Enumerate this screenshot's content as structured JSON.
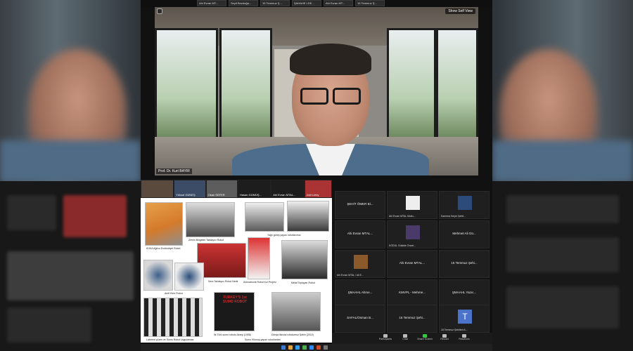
{
  "window": {
    "title": ""
  },
  "top_strip": {
    "tiles": [
      {
        "label": "Ahi Evran MT..."
      },
      {
        "label": "Seyit Bozdoğa..."
      },
      {
        "label": "15 Temmuz Ş..."
      },
      {
        "label": "ŞAHAHE LDE..."
      },
      {
        "label": "Ahi Evran MT..."
      },
      {
        "label": "15 Temmuz Ş..."
      }
    ]
  },
  "speaker": {
    "show_self_view": "Show Self View",
    "name": "Prof. Dr. Kurt BAYIR"
  },
  "share": {
    "strip": [
      {
        "label": ""
      },
      {
        "label": "Yüksel GÜNEŞ"
      },
      {
        "label": "Okan SEFER"
      },
      {
        "label": "Hasan GÜMÜŞ..."
      },
      {
        "label": "Ahi Evran MTAL..."
      },
      {
        "label": "Joel Lleby"
      }
    ],
    "captions": {
      "kuka": "KUKA Ağılcu Endüstriyel Robot",
      "cizgi": "Zemin Bölgeleri Takılayıcı Robot",
      "yagli": "Yağlı güreş yapan robotlarımız.",
      "sera": "Sera Takılayıcı Robot Nedir",
      "animatronik": "Animatronik Robot Kol Projesi",
      "metal": "Metal Toplayan Robot",
      "amfi": "Amfi Küre Robot",
      "sumo_title": "TURKEY'S 1st SUMO ROBOT",
      "ilk_sumo": "İlk Türk sumo robotu Akrep (1998)",
      "dunya": "Dünya ikincisi robotumuz Şahin (2010)",
      "sumo_eng": "Sumo Kilonuş yapan robotlardan",
      "labirent": "Labirent çözen ve Sumo Robot Uygulaması"
    }
  },
  "grid": {
    "cells": [
      {
        "name": "ŞEHİT ÖMER Bİ...",
        "small": ""
      },
      {
        "name": "",
        "small": "Ahi Evran MTAL Mutlu..."
      },
      {
        "name": "",
        "small": "Kamena Seçer Şehit..."
      },
      {
        "name": "Ahi Evran MTAL...",
        "small": ""
      },
      {
        "name": "",
        "small": "KÖDÜL Güldide Öncel..."
      },
      {
        "name": "Mehmet Ali Gü...",
        "small": ""
      },
      {
        "name": "",
        "small": "Ahi Evran MTAL / Ali E..."
      },
      {
        "name": "Ahi Evran MTAL...",
        "small": ""
      },
      {
        "name": "15 Temmuz Şehi...",
        "small": ""
      },
      {
        "name": "ŞMAAHL Ahme...",
        "small": ""
      },
      {
        "name": "KMVPL - Mehme...",
        "small": ""
      },
      {
        "name": "ŞMAAHL Yazıc...",
        "small": ""
      },
      {
        "name": "SAFAL/Osman B...",
        "small": ""
      },
      {
        "name": "15 Temmuz Şehi...",
        "small": ""
      },
      {
        "name": "",
        "small": "15 Temmuz Şehitleri A..."
      }
    ],
    "avatar_letter": "T"
  },
  "toolbar": {
    "buttons": [
      {
        "label": "Participants",
        "icon": "participants-icon"
      },
      {
        "label": "Chat",
        "icon": "chat-icon"
      },
      {
        "label": "Share Screen",
        "icon": "share-screen-icon"
      },
      {
        "label": "Record",
        "icon": "record-icon"
      },
      {
        "label": "Reactions",
        "icon": "reactions-icon"
      }
    ]
  },
  "colors": {
    "share_accent": "#2ecc40",
    "avatar_bg": "#4a73c9"
  }
}
